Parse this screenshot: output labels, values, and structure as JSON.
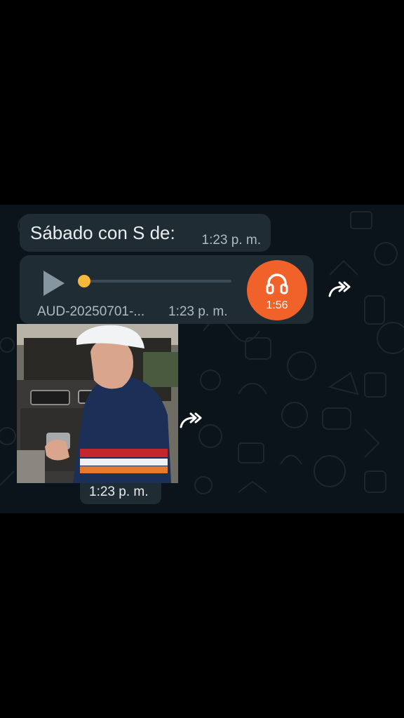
{
  "messages": {
    "text": {
      "body": "Sábado con S de:",
      "time": "1:23 p. m."
    },
    "audio": {
      "filename": "AUD-20250701-...",
      "time": "1:23 p. m.",
      "duration": "1:56",
      "progress": 0.0
    },
    "photo": {
      "time": "1:23 p. m."
    }
  },
  "icons": {
    "play": "play-icon",
    "headphones": "headphones-icon",
    "forward": "forward-icon"
  },
  "colors": {
    "chat_bg": "#0b141a",
    "bubble": "#1f2c34",
    "accent_orange": "#f0622a",
    "seek_knob": "#f6b73c"
  }
}
